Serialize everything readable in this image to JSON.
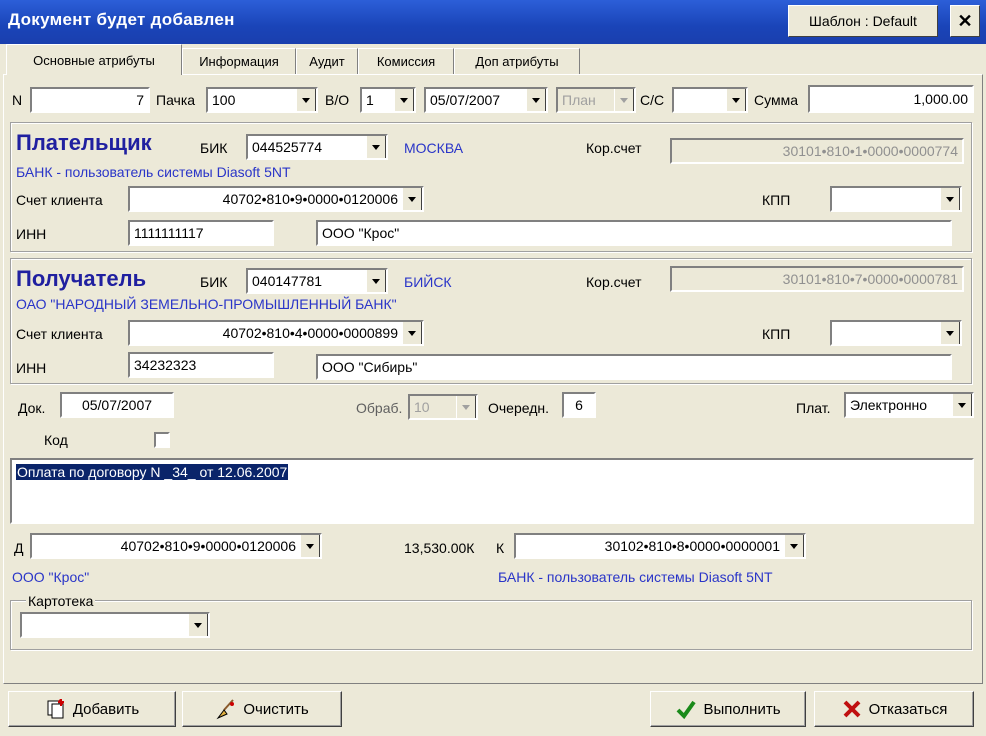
{
  "window": {
    "title": "Документ будет добавлен",
    "template_btn": "Шаблон : Default",
    "close": "✕"
  },
  "tabs": [
    "Основные атрибуты",
    "Информация",
    "Аудит",
    "Комиссия",
    "Доп атрибуты"
  ],
  "row1": {
    "n_label": "N",
    "n_value": "7",
    "pack_label": "Пачка",
    "pack_value": "100",
    "vo_label": "В/О",
    "vo_value": "1",
    "date_value": "05/07/2007",
    "plan_value": "План",
    "cs_label": "С/С",
    "cs_value": "",
    "sum_label": "Сумма",
    "sum_value": "1,000.00"
  },
  "payer": {
    "heading": "Плательщик",
    "bik_label": "БИК",
    "bik_value": "044525774",
    "city": "МОСКВА",
    "kor_label": "Кор.счет",
    "kor_value": "30101•810•1•0000•0000774",
    "bank": "БАНК - пользователь системы Diasoft 5NT",
    "acct_label": "Счет клиента",
    "acct_value": "40702•810•9•0000•0120006",
    "kpp_label": "КПП",
    "kpp_value": "",
    "inn_label": "ИНН",
    "inn_value": "1111111117",
    "name": "ООО \"Крос\""
  },
  "receiver": {
    "heading": "Получатель",
    "bik_label": "БИК",
    "bik_value": "040147781",
    "city": "БИЙСК",
    "kor_label": "Кор.счет",
    "kor_value": "30101•810•7•0000•0000781",
    "bank": "ОАО \"НАРОДНЫЙ ЗЕМЕЛЬНО-ПРОМЫШЛЕННЫЙ БАНК\"",
    "acct_label": "Счет клиента",
    "acct_value": "40702•810•4•0000•0000899",
    "kpp_label": "КПП",
    "kpp_value": "",
    "inn_label": "ИНН",
    "inn_value": "34232323",
    "name": "ООО \"Сибирь\""
  },
  "doc": {
    "doc_label": "Док.",
    "doc_value": "05/07/2007",
    "obrab_label": "Обраб.",
    "obrab_value": "10",
    "queue_label": "Очередн.",
    "queue_value": "6",
    "plat_label": "Плат.",
    "plat_value": "Электронно",
    "code_label": "Код"
  },
  "purpose": "Оплата по договору N _34_ от 12.06.2007",
  "accounts": {
    "d_label": "Д",
    "d_value": "40702•810•9•0000•0120006",
    "amount": "13,530.00К",
    "k_label": "К",
    "k_value": "30102•810•8•0000•0000001",
    "d_name": "ООО \"Крос\"",
    "k_name": "БАНК - пользователь системы Diasoft 5NT"
  },
  "kartoteka": {
    "label": "Картотека",
    "value": ""
  },
  "buttons": {
    "add": "Добавить",
    "clear": "Очистить",
    "execute": "Выполнить",
    "cancel": "Отказаться"
  }
}
